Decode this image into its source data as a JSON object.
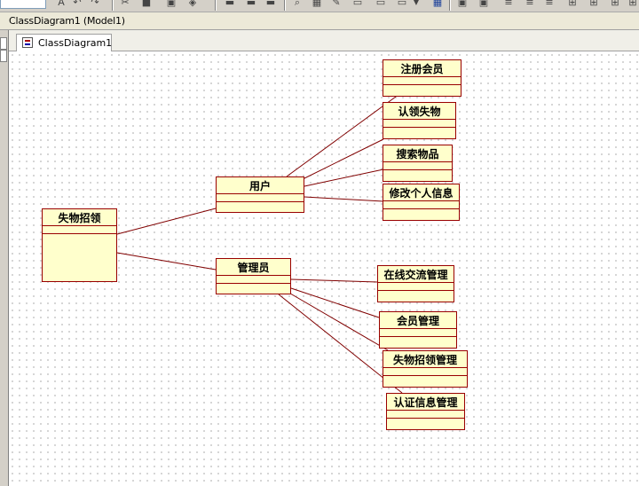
{
  "window": {
    "title": "ClassDiagram1 (Model1)"
  },
  "tab": {
    "label": "ClassDiagram1"
  },
  "toolbar": {
    "icons": [
      "text-tool-icon",
      "undo-icon",
      "redo-icon",
      "cut-icon",
      "copy-icon",
      "paste-icon",
      "align-left-icon",
      "align-center-icon",
      "align-right-icon",
      "link-icon",
      "zoom-icon",
      "layout-icon",
      "grid-icon",
      "print-icon",
      "format-icon",
      "distribute-icon",
      "window-icon",
      "tile-icon",
      "cascade-icon"
    ]
  },
  "colors": {
    "class_fill": "#ffffcc",
    "class_border": "#990000",
    "link": "#800000"
  },
  "diagram": {
    "classes": {
      "main": "失物招领",
      "user": "用户",
      "admin": "管理员",
      "register": "注册会员",
      "claim": "认领失物",
      "search": "搜索物品",
      "edit": "修改个人信息",
      "chat": "在线交流管理",
      "member": "会员管理",
      "lostfound": "失物招领管理",
      "verify": "认证信息管理"
    },
    "associations": [
      [
        "main",
        "user"
      ],
      [
        "main",
        "admin"
      ],
      [
        "user",
        "register"
      ],
      [
        "user",
        "claim"
      ],
      [
        "user",
        "search"
      ],
      [
        "user",
        "edit"
      ],
      [
        "admin",
        "chat"
      ],
      [
        "admin",
        "member"
      ],
      [
        "admin",
        "lostfound"
      ],
      [
        "admin",
        "verify"
      ]
    ]
  }
}
